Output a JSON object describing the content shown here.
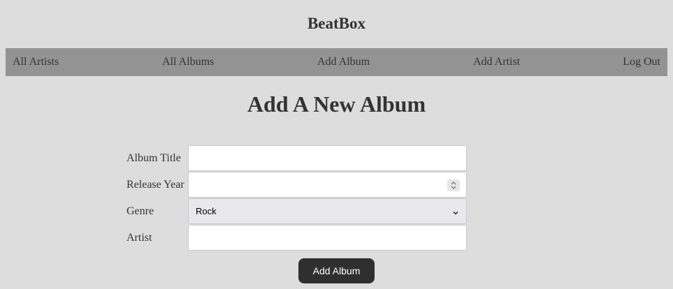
{
  "header": {
    "site_title": "BeatBox"
  },
  "nav": {
    "items": [
      {
        "label": "All Artists"
      },
      {
        "label": "All Albums"
      },
      {
        "label": "Add Album"
      },
      {
        "label": "Add Artist"
      },
      {
        "label": "Log Out"
      }
    ]
  },
  "main": {
    "page_title": "Add A New Album",
    "form": {
      "album_title": {
        "label": "Album Title",
        "value": "",
        "placeholder": ""
      },
      "release_year": {
        "label": "Release Year",
        "value": "",
        "placeholder": ""
      },
      "genre": {
        "label": "Genre",
        "selected": "Rock"
      },
      "artist": {
        "label": "Artist",
        "value": "",
        "placeholder": ""
      },
      "submit_label": "Add Album"
    }
  },
  "icons": {
    "genre_dropdown": "chevron-down-icon",
    "year_stepper": "up-down-stepper-icon"
  },
  "colors": {
    "page_background": "#dddddd",
    "nav_background": "#939393",
    "text": "#333333",
    "button_background": "#2f2f2f",
    "button_text": "#ffffff",
    "select_background": "#e8e8ed"
  }
}
